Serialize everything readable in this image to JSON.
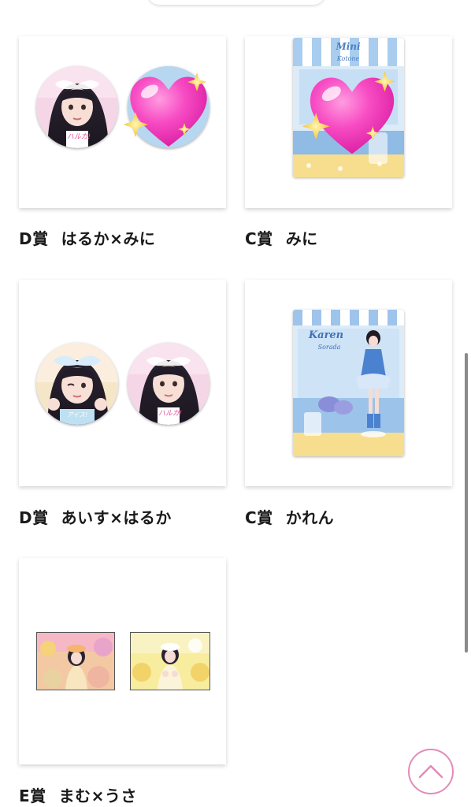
{
  "prizes": [
    {
      "grade": "D賞",
      "name": "はるか×みに"
    },
    {
      "grade": "C賞",
      "name": "みに"
    },
    {
      "grade": "D賞",
      "name": "あいす×はるか"
    },
    {
      "grade": "C賞",
      "name": "かれん"
    },
    {
      "grade": "E賞",
      "name": "まむ×うさ"
    }
  ],
  "badge_text": {
    "haruka": "ハルカ!",
    "aisu": "アイス!"
  },
  "stand_text": {
    "mini_top": "Mini",
    "mini_sub": "Kotone",
    "karen_top": "Karen",
    "karen_sub": "Sorada"
  },
  "icons": {
    "heart": "sparkling-heart-emoji",
    "scroll_top": "chevron-up-icon"
  },
  "colors": {
    "accent": "#e38bb9",
    "text": "#1a1a1a",
    "stand_blue": "#9ec4ec"
  }
}
